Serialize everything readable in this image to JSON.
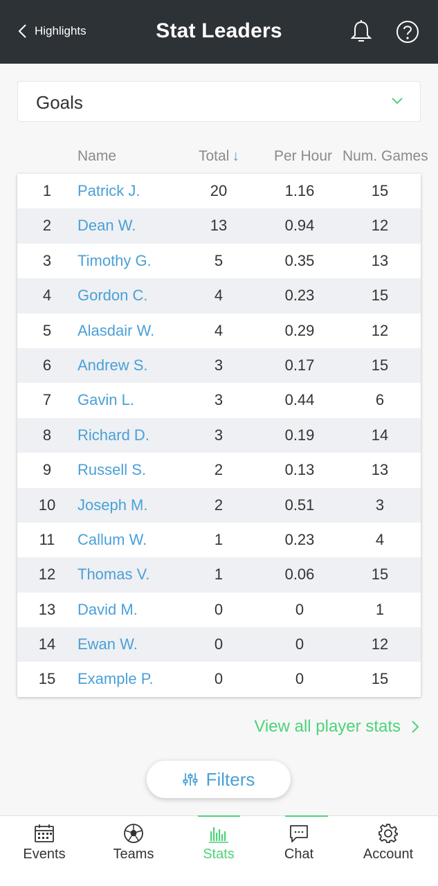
{
  "header": {
    "back_label": "Highlights",
    "title": "Stat Leaders",
    "bell_icon": "bell-icon",
    "help_icon": "help-icon"
  },
  "stat_select": {
    "value": "Goals"
  },
  "columns": {
    "name": "Name",
    "total": "Total",
    "total_sort": "↓",
    "per_hour": "Per Hour",
    "games": "Num. Games"
  },
  "rows": [
    {
      "rank": "1",
      "name": "Patrick J.",
      "total": "20",
      "per_hour": "1.16",
      "games": "15"
    },
    {
      "rank": "2",
      "name": "Dean W.",
      "total": "13",
      "per_hour": "0.94",
      "games": "12"
    },
    {
      "rank": "3",
      "name": "Timothy G.",
      "total": "5",
      "per_hour": "0.35",
      "games": "13"
    },
    {
      "rank": "4",
      "name": "Gordon C.",
      "total": "4",
      "per_hour": "0.23",
      "games": "15"
    },
    {
      "rank": "5",
      "name": "Alasdair W.",
      "total": "4",
      "per_hour": "0.29",
      "games": "12"
    },
    {
      "rank": "6",
      "name": "Andrew S.",
      "total": "3",
      "per_hour": "0.17",
      "games": "15"
    },
    {
      "rank": "7",
      "name": "Gavin L.",
      "total": "3",
      "per_hour": "0.44",
      "games": "6"
    },
    {
      "rank": "8",
      "name": "Richard D.",
      "total": "3",
      "per_hour": "0.19",
      "games": "14"
    },
    {
      "rank": "9",
      "name": "Russell S.",
      "total": "2",
      "per_hour": "0.13",
      "games": "13"
    },
    {
      "rank": "10",
      "name": "Joseph M.",
      "total": "2",
      "per_hour": "0.51",
      "games": "3"
    },
    {
      "rank": "11",
      "name": "Callum W.",
      "total": "1",
      "per_hour": "0.23",
      "games": "4"
    },
    {
      "rank": "12",
      "name": "Thomas V.",
      "total": "1",
      "per_hour": "0.06",
      "games": "15"
    },
    {
      "rank": "13",
      "name": "David M.",
      "total": "0",
      "per_hour": "0",
      "games": "1"
    },
    {
      "rank": "14",
      "name": "Ewan W.",
      "total": "0",
      "per_hour": "0",
      "games": "12"
    },
    {
      "rank": "15",
      "name": "Example P.",
      "total": "0",
      "per_hour": "0",
      "games": "15"
    }
  ],
  "view_all_label": "View all player stats",
  "filters_label": "Filters",
  "tabs": [
    {
      "label": "Events",
      "icon": "calendar-icon"
    },
    {
      "label": "Teams",
      "icon": "soccer-ball-icon"
    },
    {
      "label": "Stats",
      "icon": "bar-chart-icon",
      "active": true
    },
    {
      "label": "Chat",
      "icon": "chat-bubble-icon"
    },
    {
      "label": "Account",
      "icon": "gear-icon"
    }
  ],
  "colors": {
    "header_bg": "#2d3237",
    "accent_blue": "#4aa0d8",
    "accent_green": "#4cd37a",
    "stripe": "#eef0f3"
  }
}
